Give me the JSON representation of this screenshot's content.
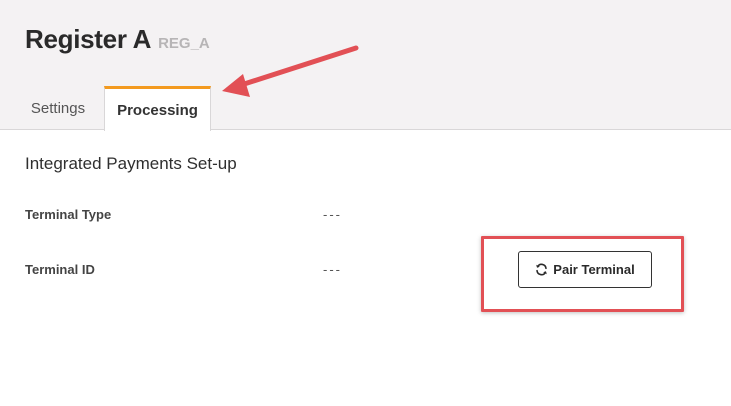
{
  "header": {
    "title": "Register A",
    "subtitle": "REG_A"
  },
  "tabs": [
    {
      "label": "Settings",
      "active": false
    },
    {
      "label": "Processing",
      "active": true
    }
  ],
  "section": {
    "title": "Integrated Payments Set-up",
    "rows": [
      {
        "label": "Terminal Type",
        "value": "---"
      },
      {
        "label": "Terminal ID",
        "value": "---"
      }
    ]
  },
  "actions": {
    "pair_terminal_label": "Pair Terminal",
    "pair_terminal_icon": "refresh-icon"
  },
  "colors": {
    "active_tab_accent": "#f39a1e",
    "annotation_red": "#e25055"
  }
}
